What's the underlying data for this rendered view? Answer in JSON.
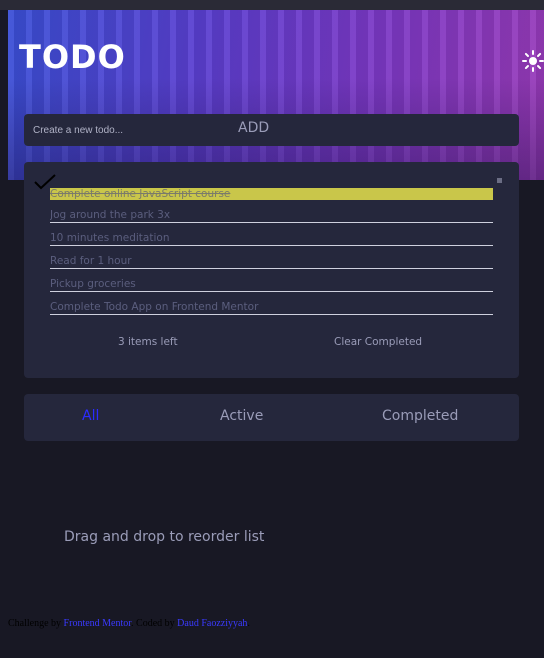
{
  "app": {
    "title": "TODO"
  },
  "new_todo": {
    "placeholder": "Create a new todo...",
    "add_label": "ADD"
  },
  "todos": [
    {
      "text": "Complete online JavaScript course",
      "completed": true
    },
    {
      "text": "Jog around the park 3x",
      "completed": false
    },
    {
      "text": "10 minutes meditation",
      "completed": false
    },
    {
      "text": "Read for 1 hour",
      "completed": false
    },
    {
      "text": "Pickup groceries",
      "completed": false
    },
    {
      "text": "Complete Todo App on Frontend Mentor",
      "completed": false
    }
  ],
  "footer": {
    "items_left": "3 items left",
    "clear_label": "Clear Completed"
  },
  "filters": [
    {
      "label": "All",
      "active": true
    },
    {
      "label": "Active",
      "active": false
    },
    {
      "label": "Completed",
      "active": false
    }
  ],
  "hint": "Drag and drop to reorder list",
  "attribution": {
    "prefix": "Challenge by",
    "frontend_mentor": "Frontend Mentor",
    "middle": ". Coded by",
    "author": "Daud Faozziyyah",
    "suffix": "."
  },
  "colors": {
    "accent": "#2b2bff",
    "highlight": "#c9c64a",
    "panel": "#25273c",
    "background": "#181824"
  },
  "icons": {
    "theme": "sun-icon",
    "check": "check-icon",
    "close": "close-icon"
  }
}
